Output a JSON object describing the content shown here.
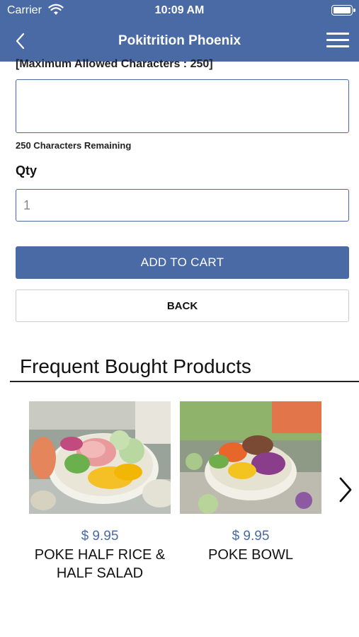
{
  "status_bar": {
    "carrier": "Carrier",
    "time": "10:09 AM"
  },
  "navbar": {
    "title": "Pokitrition Phoenix"
  },
  "form": {
    "max_chars_label": "[Maximum Allowed Characters : 250]",
    "textarea_value": "",
    "remaining_label": "250 Characters Remaining",
    "qty_label": "Qty",
    "qty_value": "1",
    "add_to_cart_label": "ADD TO CART",
    "back_label": "BACK"
  },
  "frequent": {
    "title": "Frequent Bought Products",
    "products": [
      {
        "price": "$ 9.95",
        "name": "POKE HALF RICE & HALF SALAD",
        "image": "poke-half-rice-half-salad-photo"
      },
      {
        "price": "$ 9.95",
        "name": "POKE BOWL",
        "image": "poke-bowl-photo"
      }
    ]
  },
  "colors": {
    "primary": "#4a6aa5",
    "text": "#111111"
  },
  "icons": [
    "wifi-icon",
    "battery-icon",
    "back-arrow-icon",
    "menu-icon",
    "chevron-right-icon"
  ]
}
